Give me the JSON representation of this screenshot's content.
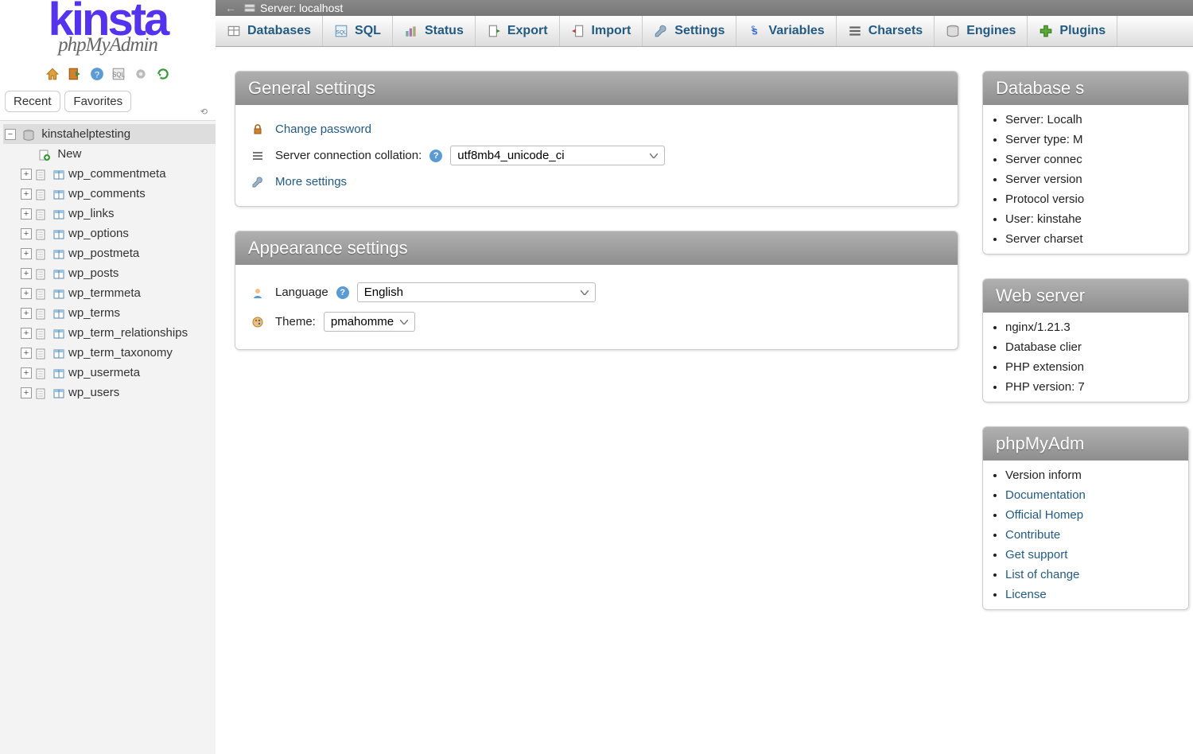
{
  "brand": {
    "top": "kinsta",
    "sub": "phpMyAdmin"
  },
  "sidebar_tabs": {
    "recent": "Recent",
    "favorites": "Favorites"
  },
  "tree": {
    "db": "kinstahelptesting",
    "new": "New",
    "tables": [
      "wp_commentmeta",
      "wp_comments",
      "wp_links",
      "wp_options",
      "wp_postmeta",
      "wp_posts",
      "wp_termmeta",
      "wp_terms",
      "wp_term_relationships",
      "wp_term_taxonomy",
      "wp_usermeta",
      "wp_users"
    ]
  },
  "server_label": "Server: localhost",
  "tabs": [
    "Databases",
    "SQL",
    "Status",
    "Export",
    "Import",
    "Settings",
    "Variables",
    "Charsets",
    "Engines",
    "Plugins"
  ],
  "general_settings": {
    "heading": "General settings",
    "change_password": "Change password",
    "collation_label": "Server connection collation:",
    "collation_value": "utf8mb4_unicode_ci",
    "more": "More settings"
  },
  "appearance_settings": {
    "heading": "Appearance settings",
    "language_label": "Language",
    "language_value": "English",
    "theme_label": "Theme:",
    "theme_value": "pmahomme"
  },
  "db_server": {
    "heading": "Database s",
    "items": [
      "Server: Localh",
      "Server type: M",
      "Server connec",
      "Server version",
      "Protocol versio",
      "User: kinstahe",
      "Server charset"
    ]
  },
  "web_server": {
    "heading": "Web server",
    "items": [
      "nginx/1.21.3",
      "Database clier",
      "PHP extension",
      "PHP version: 7"
    ]
  },
  "pma": {
    "heading": "phpMyAdm",
    "items": [
      "Version inform",
      "Documentation",
      "Official Homep",
      "Contribute",
      "Get support",
      "List of change",
      "License"
    ],
    "link_indices": [
      1,
      2,
      3,
      4,
      5,
      6
    ]
  }
}
